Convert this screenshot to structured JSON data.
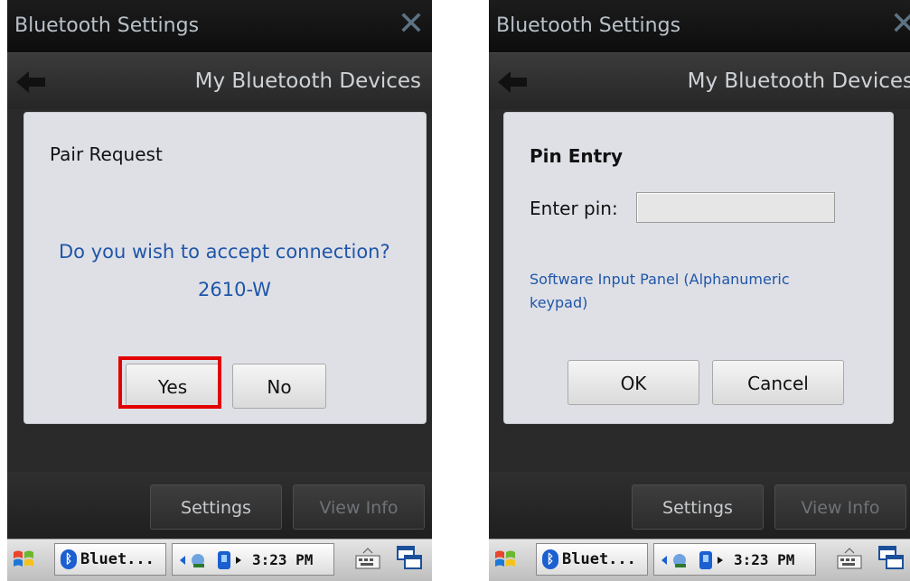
{
  "left": {
    "window_title": "Bluetooth Settings",
    "header_title": "My Bluetooth Devices",
    "dialog": {
      "title": "Pair Request",
      "question": "Do you wish to accept connection?",
      "device": "2610-W",
      "yes_label": "Yes",
      "no_label": "No"
    },
    "bottom": {
      "settings_label": "Settings",
      "view_info_label": "View Info"
    },
    "taskbar": {
      "app_label": "Bluet...",
      "clock": "3:23 PM"
    }
  },
  "right": {
    "window_title": "Bluetooth Settings",
    "header_title": "My Bluetooth Devices",
    "dialog": {
      "title": "Pin Entry",
      "pin_label": "Enter pin:",
      "pin_value": "",
      "sip_text": "Software Input Panel (Alphanumeric keypad)",
      "ok_label": "OK",
      "cancel_label": "Cancel"
    },
    "bottom": {
      "settings_label": "Settings",
      "view_info_label": "View Info"
    },
    "taskbar": {
      "app_label": "Bluet...",
      "clock": "3:23 PM"
    }
  },
  "colors": {
    "highlight": "#e30000",
    "link_blue": "#1f56a8"
  },
  "icons": [
    "back-arrow-icon",
    "close-icon",
    "windows-start-icon",
    "bluetooth-icon",
    "network-icon",
    "battery-icon",
    "keyboard-icon",
    "window-switch-icon"
  ]
}
